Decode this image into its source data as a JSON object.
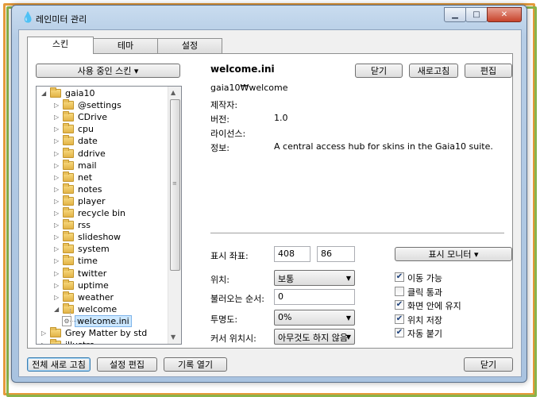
{
  "window": {
    "title": "레인미터 관리"
  },
  "tabs": [
    "스킨",
    "테마",
    "설정"
  ],
  "skins_button": "사용 중인 스킨 ▾",
  "tree": [
    {
      "label": "gaia10",
      "level": 0,
      "expanded": true
    },
    {
      "label": "@settings",
      "level": 1
    },
    {
      "label": "CDrive",
      "level": 1
    },
    {
      "label": "cpu",
      "level": 1
    },
    {
      "label": "date",
      "level": 1
    },
    {
      "label": "ddrive",
      "level": 1
    },
    {
      "label": "mail",
      "level": 1
    },
    {
      "label": "net",
      "level": 1
    },
    {
      "label": "notes",
      "level": 1
    },
    {
      "label": "player",
      "level": 1
    },
    {
      "label": "recycle bin",
      "level": 1
    },
    {
      "label": "rss",
      "level": 1
    },
    {
      "label": "slideshow",
      "level": 1
    },
    {
      "label": "system",
      "level": 1
    },
    {
      "label": "time",
      "level": 1
    },
    {
      "label": "twitter",
      "level": 1
    },
    {
      "label": "uptime",
      "level": 1
    },
    {
      "label": "weather",
      "level": 1
    },
    {
      "label": "welcome",
      "level": 1,
      "expanded": true
    },
    {
      "label": "welcome.ini",
      "level": 2,
      "file": true,
      "selected": true
    },
    {
      "label": "Grey Matter by std",
      "level": 0
    },
    {
      "label": "illustro",
      "level": 0
    }
  ],
  "details": {
    "name": "welcome.ini",
    "path": "gaia10₩welcome",
    "author_label": "제작자:",
    "author_value": "",
    "version_label": "버전:",
    "version_value": "1.0",
    "license_label": "라이선스:",
    "license_value": "",
    "info_label": "정보:",
    "info_value": "A central access hub for skins in the Gaia10 suite."
  },
  "top_buttons": {
    "close": "닫기",
    "refresh": "새로고침",
    "edit": "편집"
  },
  "settings": {
    "coords_label": "표시 좌표:",
    "x": "408",
    "y": "86",
    "monitor_button": "표시 모니터 ▾",
    "position_label": "위치:",
    "position_value": "보통",
    "load_order_label": "불러오는 순서:",
    "load_order_value": "0",
    "transparency_label": "투명도:",
    "transparency_value": "0%",
    "hover_label": "커서 위치시:",
    "hover_value": "아무것도 하지 않음"
  },
  "checkboxes": [
    {
      "label": "이동 가능",
      "checked": true
    },
    {
      "label": "클릭 통과",
      "checked": false
    },
    {
      "label": "화면 안에 유지",
      "checked": true
    },
    {
      "label": "위치 저장",
      "checked": true
    },
    {
      "label": "자동 붙기",
      "checked": true
    }
  ],
  "bottom_buttons": {
    "refresh_all": "전체 새로 고침",
    "edit_settings": "설정 편집",
    "open_log": "기록 열기",
    "close": "닫기"
  }
}
